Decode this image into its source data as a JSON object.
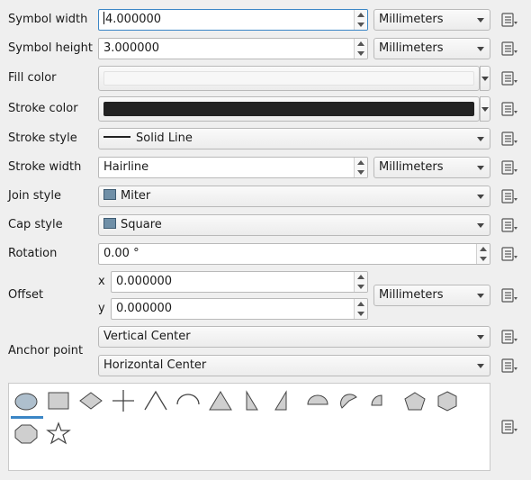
{
  "labels": {
    "symbol_width": "Symbol width",
    "symbol_height": "Symbol height",
    "fill_color": "Fill color",
    "stroke_color": "Stroke color",
    "stroke_style": "Stroke style",
    "stroke_width": "Stroke width",
    "join_style": "Join style",
    "cap_style": "Cap style",
    "rotation": "Rotation",
    "offset": "Offset",
    "anchor_point": "Anchor point",
    "x": "x",
    "y": "y"
  },
  "values": {
    "symbol_width": "4.000000",
    "symbol_height": "3.000000",
    "stroke_width": "Hairline",
    "rotation": "0.00 °",
    "offset_x": "0.000000",
    "offset_y": "0.000000"
  },
  "units": {
    "width": "Millimeters",
    "height": "Millimeters",
    "stroke": "Millimeters",
    "offset": "Millimeters"
  },
  "combos": {
    "stroke_style": "Solid Line",
    "join_style": "Miter",
    "cap_style": "Square",
    "anchor_vertical": "Vertical Center",
    "anchor_horizontal": "Horizontal Center"
  },
  "colors": {
    "fill": "#f7f7f7",
    "stroke": "#222222",
    "accent": "#3b86c6"
  },
  "shapes": [
    "ellipse-icon",
    "rectangle-icon",
    "diamond-icon",
    "cross-icon",
    "triangle-outline-icon",
    "arc-icon",
    "triangle-icon",
    "right-half-triangle-icon",
    "left-half-triangle-icon",
    "semicircle-icon",
    "third-circle-icon",
    "quarter-circle-icon",
    "pentagon-icon",
    "hexagon-icon",
    "octagon-icon",
    "star-icon"
  ],
  "selected_shape": "ellipse-icon",
  "data_defined_icon": "data-defined-override-icon"
}
